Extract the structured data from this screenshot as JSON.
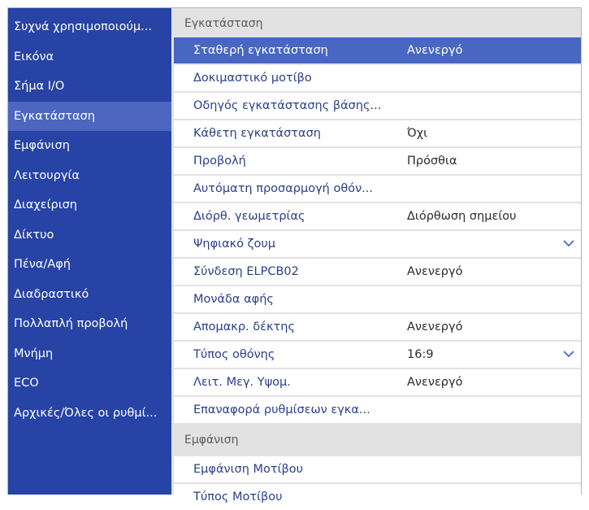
{
  "sidebar": {
    "items": [
      {
        "label": "Συχνά χρησιμοποιούμ..."
      },
      {
        "label": "Εικόνα"
      },
      {
        "label": "Σήμα I/O"
      },
      {
        "label": "Εγκατάσταση"
      },
      {
        "label": "Εμφάνιση"
      },
      {
        "label": "Λειτουργία"
      },
      {
        "label": "Διαχείριση"
      },
      {
        "label": "Δίκτυο"
      },
      {
        "label": "Πένα/Αφή"
      },
      {
        "label": "Διαδραστικό"
      },
      {
        "label": "Πολλαπλή προβολή"
      },
      {
        "label": "Μνήμη"
      },
      {
        "label": "ECO"
      },
      {
        "label": "Αρχικές/Όλες οι ρυθμί..."
      }
    ],
    "active_index": 3
  },
  "main": {
    "section1_title": "Εγκατάσταση",
    "rows": [
      {
        "label": "Σταθερή εγκατάσταση",
        "value": "Ανενεργό"
      },
      {
        "label": "Δοκιμαστικό μοτίβο",
        "value": ""
      },
      {
        "label": "Οδηγός εγκατάστασης βάσης...",
        "value": ""
      },
      {
        "label": "Κάθετη εγκατάσταση",
        "value": "Όχι"
      },
      {
        "label": "Προβολή",
        "value": "Πρόσθια"
      },
      {
        "label": "Αυτόματη προσαρμογή οθόν...",
        "value": ""
      },
      {
        "label": "Διόρθ. γεωμετρίας",
        "value": "Διόρθωση σημείου"
      },
      {
        "label": "Ψηφιακό ζουμ",
        "value": ""
      },
      {
        "label": "Σύνδεση ELPCB02",
        "value": "Ανενεργό"
      },
      {
        "label": "Μονάδα αφής",
        "value": ""
      },
      {
        "label": "Απομακρ. δέκτης",
        "value": "Ανενεργό"
      },
      {
        "label": "Τύπος οθόνης",
        "value": "16:9"
      },
      {
        "label": "Λειτ. Μεγ. Υψομ.",
        "value": "Ανενεργό"
      },
      {
        "label": "Επαναφορά ρυθμίσεων εγκα...",
        "value": ""
      }
    ],
    "section2_title": "Εμφάνιση",
    "rows2": [
      {
        "label": "Εμφάνιση Μοτίβου"
      },
      {
        "label": "Τύπος Μοτίβου"
      }
    ]
  },
  "icons": {
    "expand": "chevron-down-icon"
  },
  "colors": {
    "sidebar_bg": "#2743a5",
    "sidebar_active": "#4d67c0",
    "row_selected": "#4866c2",
    "row_text": "#2a3f8a"
  }
}
